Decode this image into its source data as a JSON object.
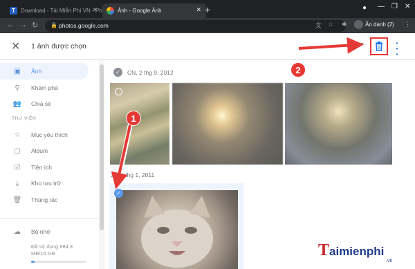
{
  "browser": {
    "tabs": [
      {
        "title": "Download - Tải Miễn Phí VN - Ph",
        "favicon": "T"
      },
      {
        "title": "Ảnh - Google Ảnh",
        "favicon": "pinwheel"
      }
    ],
    "url": "photos.google.com",
    "profile_label": "Ẩn danh (2)"
  },
  "appbar": {
    "selection_text": "1 ảnh được chọn"
  },
  "sidebar": {
    "items": [
      {
        "label": "Ảnh",
        "icon": "photo-icon",
        "active": true
      },
      {
        "label": "Khám phá",
        "icon": "search-icon"
      },
      {
        "label": "Chia sẻ",
        "icon": "people-icon"
      }
    ],
    "library_heading": "THƯ VIỆN",
    "library_items": [
      {
        "label": "Mục yêu thích",
        "icon": "star-icon"
      },
      {
        "label": "Album",
        "icon": "album-icon"
      },
      {
        "label": "Tiện ích",
        "icon": "utilities-icon"
      },
      {
        "label": "Kho lưu trữ",
        "icon": "archive-icon"
      },
      {
        "label": "Thùng rác",
        "icon": "trash-icon"
      }
    ],
    "storage": {
      "label": "Bộ nhớ",
      "icon": "cloud-icon",
      "used_line1": "Đã sử dụng 984,3",
      "used_line2": "MB/15 GB",
      "fraction": 0.064
    }
  },
  "photos": {
    "groups": [
      {
        "date": "CN, 2 thg 9, 2012"
      },
      {
        "date": "2, 24 thg 1, 2011"
      }
    ]
  },
  "annotations": {
    "step1": "1",
    "step2": "2"
  },
  "watermark": {
    "first_letter": "T",
    "rest": "aimienphi",
    "suffix": ".vn"
  },
  "colors": {
    "accent": "#1a73e8",
    "annotation_red": "#e53935"
  }
}
